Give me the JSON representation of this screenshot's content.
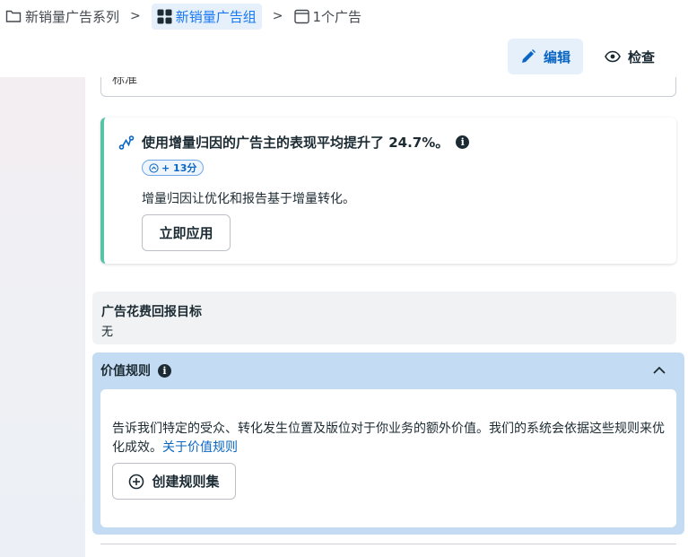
{
  "breadcrumb": {
    "campaign": "新销量广告系列",
    "adset": "新销量广告组",
    "ad": "1个广告"
  },
  "toolbar": {
    "edit_label": "编辑",
    "inspect_label": "检查"
  },
  "top_field": {
    "value": "标准"
  },
  "recommendation": {
    "title": "使用增量归因的广告主的表现平均提升了 24.7%。",
    "badge": "+ 13分",
    "description": "增量归因让优化和报告基于增量转化。",
    "apply_label": "立即应用"
  },
  "roas": {
    "title": "广告花费回报目标",
    "value": "无"
  },
  "value_rules": {
    "title": "价值规则",
    "description": "告诉我们特定的受众、转化发生位置及版位对于你业务的额外价值。我们的系统会依据这些规则来优化成效。",
    "link_label": "关于价值规则",
    "create_label": "创建规则集"
  },
  "colors": {
    "accent": "#1877f2",
    "card_border": "#59c3a5",
    "section_highlight": "#c4dcf3"
  }
}
